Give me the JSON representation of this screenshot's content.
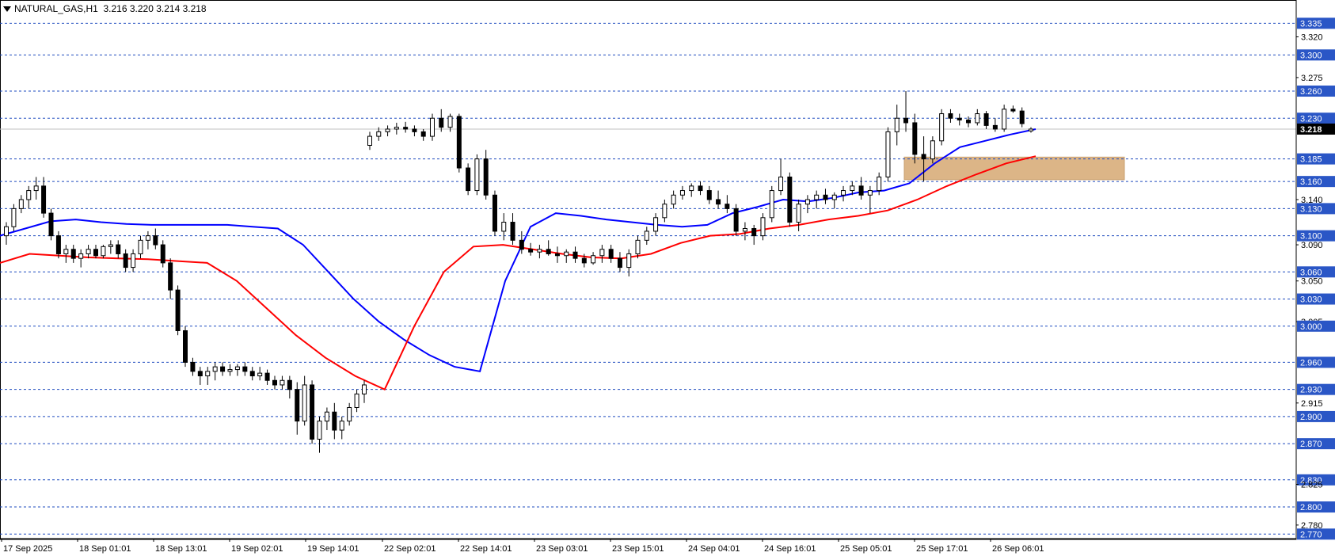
{
  "header": {
    "symbol": "NATURAL_GAS,H1",
    "ohlc": "3.216 3.220 3.214 3.218"
  },
  "chart_data": {
    "type": "candlestick",
    "symbol": "NATURAL_GAS",
    "timeframe": "H1",
    "ylim": [
      2.765,
      3.345
    ],
    "current_price": 3.218,
    "price_tick_labels": [
      "3.335",
      "3.320",
      "3.300",
      "3.275",
      "3.260",
      "3.230",
      "3.218",
      "3.185",
      "3.160",
      "3.140",
      "3.130",
      "3.100",
      "3.090",
      "3.060",
      "3.050",
      "3.030",
      "3.005",
      "3.000",
      "2.960",
      "2.930",
      "2.915",
      "2.900",
      "2.870",
      "2.830",
      "2.825",
      "2.800",
      "2.780",
      "2.770"
    ],
    "boxed_price_labels": [
      "3.335",
      "3.300",
      "3.260",
      "3.230",
      "3.185",
      "3.160",
      "3.130",
      "3.100",
      "3.060",
      "3.030",
      "3.000",
      "2.960",
      "2.930",
      "2.900",
      "2.870",
      "2.830",
      "2.800",
      "2.770"
    ],
    "horizontal_levels": [
      3.335,
      3.3,
      3.26,
      3.23,
      3.185,
      3.16,
      3.13,
      3.1,
      3.06,
      3.03,
      3.0,
      2.96,
      2.93,
      2.9,
      2.87,
      2.83,
      2.8,
      2.77
    ],
    "x_labels": [
      "17 Sep 2025",
      "18 Sep 01:01",
      "18 Sep 13:01",
      "19 Sep 02:01",
      "19 Sep 14:01",
      "22 Sep 02:01",
      "22 Sep 14:01",
      "23 Sep 03:01",
      "23 Sep 15:01",
      "24 Sep 04:01",
      "24 Sep 16:01",
      "25 Sep 05:01",
      "25 Sep 17:01",
      "26 Sep 06:01"
    ],
    "zone": {
      "price_top": 3.187,
      "price_bottom": 3.162,
      "color": "#dcb587"
    },
    "colors": {
      "grid": "#1e4bbf",
      "bull_body": "#ffffff",
      "bear_body": "#000000",
      "blue_line": "#0000ff",
      "red_line": "#ff0000"
    },
    "candles": [
      [
        3.1,
        3.115,
        3.09,
        3.11
      ],
      [
        3.11,
        3.135,
        3.105,
        3.13
      ],
      [
        3.13,
        3.145,
        3.125,
        3.14
      ],
      [
        3.14,
        3.155,
        3.13,
        3.15
      ],
      [
        3.15,
        3.165,
        3.14,
        3.155
      ],
      [
        3.155,
        3.165,
        3.12,
        3.125
      ],
      [
        3.125,
        3.13,
        3.095,
        3.1
      ],
      [
        3.1,
        3.105,
        3.075,
        3.08
      ],
      [
        3.08,
        3.09,
        3.07,
        3.085
      ],
      [
        3.085,
        3.09,
        3.07,
        3.075
      ],
      [
        3.075,
        3.085,
        3.065,
        3.08
      ],
      [
        3.08,
        3.09,
        3.075,
        3.085
      ],
      [
        3.085,
        3.09,
        3.075,
        3.078
      ],
      [
        3.078,
        3.09,
        3.075,
        3.088
      ],
      [
        3.088,
        3.095,
        3.08,
        3.09
      ],
      [
        3.09,
        3.095,
        3.075,
        3.08
      ],
      [
        3.08,
        3.085,
        3.06,
        3.065
      ],
      [
        3.065,
        3.085,
        3.06,
        3.08
      ],
      [
        3.08,
        3.1,
        3.075,
        3.095
      ],
      [
        3.095,
        3.105,
        3.085,
        3.1
      ],
      [
        3.1,
        3.108,
        3.085,
        3.09
      ],
      [
        3.09,
        3.095,
        3.065,
        3.07
      ],
      [
        3.07,
        3.075,
        3.03,
        3.04
      ],
      [
        3.04,
        3.045,
        2.99,
        2.995
      ],
      [
        2.995,
        3.0,
        2.955,
        2.96
      ],
      [
        2.96,
        2.965,
        2.945,
        2.95
      ],
      [
        2.95,
        2.955,
        2.935,
        2.945
      ],
      [
        2.945,
        2.955,
        2.935,
        2.95
      ],
      [
        2.95,
        2.96,
        2.94,
        2.955
      ],
      [
        2.955,
        2.96,
        2.945,
        2.95
      ],
      [
        2.95,
        2.958,
        2.945,
        2.952
      ],
      [
        2.952,
        2.958,
        2.945,
        2.955
      ],
      [
        2.955,
        2.96,
        2.945,
        2.95
      ],
      [
        2.95,
        2.955,
        2.94,
        2.945
      ],
      [
        2.945,
        2.955,
        2.94,
        2.948
      ],
      [
        2.948,
        2.952,
        2.935,
        2.94
      ],
      [
        2.94,
        2.945,
        2.93,
        2.935
      ],
      [
        2.935,
        2.945,
        2.93,
        2.94
      ],
      [
        2.94,
        2.945,
        2.92,
        2.93
      ],
      [
        2.93,
        2.938,
        2.88,
        2.895
      ],
      [
        2.895,
        2.945,
        2.89,
        2.935
      ],
      [
        2.935,
        2.94,
        2.87,
        2.875
      ],
      [
        2.875,
        2.9,
        2.86,
        2.895
      ],
      [
        2.895,
        2.91,
        2.885,
        2.905
      ],
      [
        2.905,
        2.915,
        2.875,
        2.885
      ],
      [
        2.885,
        2.9,
        2.875,
        2.895
      ],
      [
        2.895,
        2.915,
        2.89,
        2.91
      ],
      [
        2.91,
        2.93,
        2.905,
        2.925
      ],
      [
        2.925,
        2.94,
        2.915,
        2.935
      ],
      [
        3.2,
        3.215,
        3.195,
        3.21
      ],
      [
        3.21,
        3.22,
        3.205,
        3.215
      ],
      [
        3.215,
        3.222,
        3.21,
        3.218
      ],
      [
        3.218,
        3.225,
        3.212,
        3.22
      ],
      [
        3.22,
        3.226,
        3.214,
        3.218
      ],
      [
        3.218,
        3.222,
        3.21,
        3.215
      ],
      [
        3.215,
        3.218,
        3.205,
        3.21
      ],
      [
        3.21,
        3.235,
        3.205,
        3.23
      ],
      [
        3.23,
        3.24,
        3.215,
        3.22
      ],
      [
        3.22,
        3.235,
        3.215,
        3.232
      ],
      [
        3.232,
        3.235,
        3.17,
        3.175
      ],
      [
        3.175,
        3.18,
        3.145,
        3.15
      ],
      [
        3.15,
        3.19,
        3.145,
        3.185
      ],
      [
        3.185,
        3.195,
        3.14,
        3.145
      ],
      [
        3.145,
        3.15,
        3.1,
        3.105
      ],
      [
        3.105,
        3.125,
        3.095,
        3.115
      ],
      [
        3.115,
        3.125,
        3.09,
        3.095
      ],
      [
        3.095,
        3.105,
        3.08,
        3.085
      ],
      [
        3.085,
        3.092,
        3.078,
        3.082
      ],
      [
        3.082,
        3.09,
        3.075,
        3.085
      ],
      [
        3.085,
        3.095,
        3.078,
        3.08
      ],
      [
        3.08,
        3.088,
        3.07,
        3.078
      ],
      [
        3.078,
        3.085,
        3.07,
        3.082
      ],
      [
        3.082,
        3.088,
        3.07,
        3.075
      ],
      [
        3.075,
        3.08,
        3.065,
        3.07
      ],
      [
        3.07,
        3.082,
        3.068,
        3.078
      ],
      [
        3.078,
        3.09,
        3.07,
        3.085
      ],
      [
        3.085,
        3.09,
        3.07,
        3.075
      ],
      [
        3.075,
        3.082,
        3.06,
        3.065
      ],
      [
        3.065,
        3.085,
        3.055,
        3.08
      ],
      [
        3.08,
        3.1,
        3.075,
        3.095
      ],
      [
        3.095,
        3.11,
        3.09,
        3.105
      ],
      [
        3.105,
        3.125,
        3.1,
        3.12
      ],
      [
        3.12,
        3.14,
        3.115,
        3.135
      ],
      [
        3.135,
        3.15,
        3.13,
        3.145
      ],
      [
        3.145,
        3.155,
        3.14,
        3.15
      ],
      [
        3.15,
        3.158,
        3.143,
        3.155
      ],
      [
        3.155,
        3.16,
        3.145,
        3.15
      ],
      [
        3.15,
        3.155,
        3.135,
        3.14
      ],
      [
        3.14,
        3.15,
        3.13,
        3.135
      ],
      [
        3.135,
        3.145,
        3.125,
        3.13
      ],
      [
        3.13,
        3.135,
        3.1,
        3.105
      ],
      [
        3.105,
        3.115,
        3.095,
        3.108
      ],
      [
        3.108,
        3.112,
        3.09,
        3.1
      ],
      [
        3.1,
        3.125,
        3.095,
        3.12
      ],
      [
        3.12,
        3.155,
        3.115,
        3.15
      ],
      [
        3.15,
        3.185,
        3.145,
        3.165
      ],
      [
        3.165,
        3.17,
        3.11,
        3.115
      ],
      [
        3.115,
        3.14,
        3.105,
        3.135
      ],
      [
        3.135,
        3.145,
        3.125,
        3.14
      ],
      [
        3.14,
        3.15,
        3.13,
        3.145
      ],
      [
        3.145,
        3.152,
        3.135,
        3.14
      ],
      [
        3.14,
        3.148,
        3.13,
        3.145
      ],
      [
        3.145,
        3.155,
        3.138,
        3.15
      ],
      [
        3.15,
        3.16,
        3.145,
        3.155
      ],
      [
        3.155,
        3.165,
        3.14,
        3.145
      ],
      [
        3.145,
        3.155,
        3.125,
        3.15
      ],
      [
        3.15,
        3.17,
        3.145,
        3.165
      ],
      [
        3.165,
        3.22,
        3.16,
        3.215
      ],
      [
        3.215,
        3.245,
        3.2,
        3.23
      ],
      [
        3.23,
        3.26,
        3.215,
        3.225
      ],
      [
        3.225,
        3.235,
        3.18,
        3.19
      ],
      [
        3.19,
        3.21,
        3.16,
        3.185
      ],
      [
        3.185,
        3.21,
        3.18,
        3.205
      ],
      [
        3.205,
        3.24,
        3.2,
        3.235
      ],
      [
        3.235,
        3.24,
        3.225,
        3.23
      ],
      [
        3.23,
        3.235,
        3.222,
        3.228
      ],
      [
        3.228,
        3.232,
        3.22,
        3.225
      ],
      [
        3.225,
        3.24,
        3.222,
        3.235
      ],
      [
        3.235,
        3.238,
        3.218,
        3.222
      ],
      [
        3.222,
        3.23,
        3.215,
        3.218
      ],
      [
        3.218,
        3.245,
        3.215,
        3.24
      ],
      [
        3.24,
        3.244,
        3.236,
        3.238
      ],
      [
        3.238,
        3.242,
        3.22,
        3.224
      ],
      [
        3.216,
        3.22,
        3.214,
        3.218
      ]
    ],
    "blue_line": [
      3.1,
      3.108,
      3.116,
      3.118,
      3.115,
      3.113,
      3.112,
      3.112,
      3.112,
      3.112,
      3.11,
      3.108,
      3.09,
      3.06,
      3.03,
      3.005,
      2.985,
      2.968,
      2.955,
      2.95,
      3.05,
      3.11,
      3.125,
      3.122,
      3.118,
      3.115,
      3.112,
      3.11,
      3.112,
      3.125,
      3.132,
      3.14,
      3.138,
      3.142,
      3.148,
      3.15,
      3.158,
      3.18,
      3.198,
      3.205,
      3.212,
      3.218
    ],
    "red_line": [
      3.07,
      3.08,
      3.078,
      3.076,
      3.075,
      3.074,
      3.072,
      3.07,
      3.05,
      3.02,
      2.99,
      2.965,
      2.945,
      2.93,
      3.0,
      3.06,
      3.088,
      3.09,
      3.085,
      3.08,
      3.076,
      3.075,
      3.08,
      3.092,
      3.1,
      3.102,
      3.108,
      3.112,
      3.118,
      3.122,
      3.128,
      3.14,
      3.155,
      3.168,
      3.18,
      3.188
    ]
  }
}
